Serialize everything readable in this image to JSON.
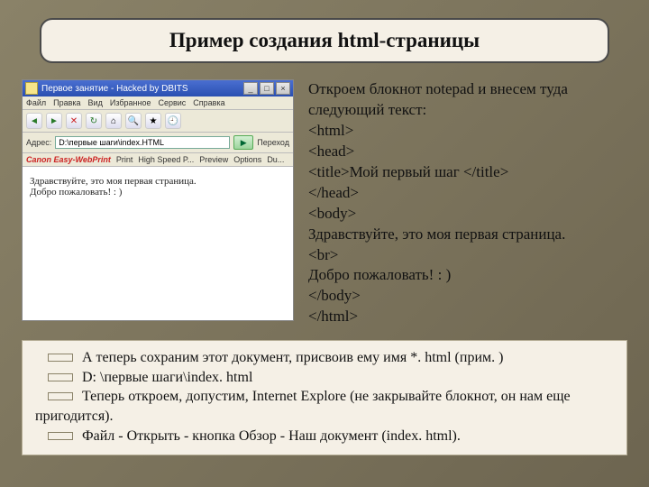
{
  "title": "Пример создания html-страницы",
  "browser": {
    "window_title": "Первое занятие - Hacked by DBITS",
    "menu": [
      "Файл",
      "Правка",
      "Вид",
      "Избранное",
      "Сервис",
      "Справка"
    ],
    "address_label": "Адрес:",
    "address_value": "D:\\первые шаги\\index.HTML",
    "go_label": "Переход",
    "easyprint_brand": "Canon Easy-WebPrint",
    "easyprint_buttons": [
      "Print",
      "High Speed P...",
      "Preview",
      "Options",
      "Du..."
    ],
    "page_line1": "Здравствуйте, это моя первая страница.",
    "page_line2": "Добро пожаловать! : )"
  },
  "code": {
    "intro": "Откроем блокнот notepad и внесем туда следующий текст:",
    "lines": [
      "<html>",
      "<head>",
      "<title>Мой первый шаг </title>",
      "</head>",
      "<body>",
      "Здравствуйте, это моя первая страница.",
      "<br>",
      "Добро пожаловать! : )",
      "</body>",
      "</html>"
    ]
  },
  "notes": {
    "b1": "А теперь сохраним этот документ, присвоив ему имя *. html (прим. )",
    "b2": "D: \\первые шаги\\index. html",
    "b3a": "Теперь откроем, допустим, Internet Explore (не закрывайте блокнот, он нам еще",
    "b3b": "пригодится).",
    "b4": "Файл - Открыть - кнопка Обзор - Наш документ (index. html)."
  }
}
